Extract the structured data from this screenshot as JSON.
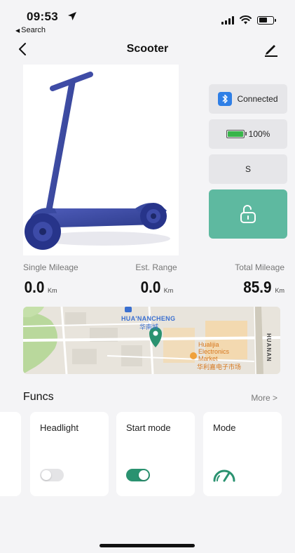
{
  "status_bar": {
    "time": "09:53",
    "back_app": "Search"
  },
  "nav": {
    "title": "Scooter"
  },
  "device": {
    "connection_label": "Connected",
    "battery_percent": "100%",
    "battery_level": 1.0,
    "speed_mode": "S"
  },
  "stats": [
    {
      "label": "Single Mileage",
      "value": "0.0",
      "unit": "Km"
    },
    {
      "label": "Est. Range",
      "value": "0.0",
      "unit": "Km"
    },
    {
      "label": "Total Mileage",
      "value": "85.9",
      "unit": "Km"
    }
  ],
  "map": {
    "place_en": "HUA'NANCHENG",
    "place_cn": "华南城",
    "market_en_1": "Hualijia",
    "market_en_2": "Electronics",
    "market_en_3": "Market",
    "market_cn": "华利嘉电子市场",
    "road_label": "HUANAN"
  },
  "funcs": {
    "title": "Funcs",
    "more_label": "More >",
    "cards": [
      {
        "title": "Headlight",
        "state": "off"
      },
      {
        "title": "Start mode",
        "state": "on"
      },
      {
        "title": "Mode",
        "icon": "gauge-icon"
      }
    ]
  },
  "colors": {
    "bluetooth": "#2f7fe6",
    "battery": "#38b54a",
    "lock_button": "#5eb9a0",
    "toggle_on": "#2a9270",
    "gauge": "#2a9270"
  }
}
